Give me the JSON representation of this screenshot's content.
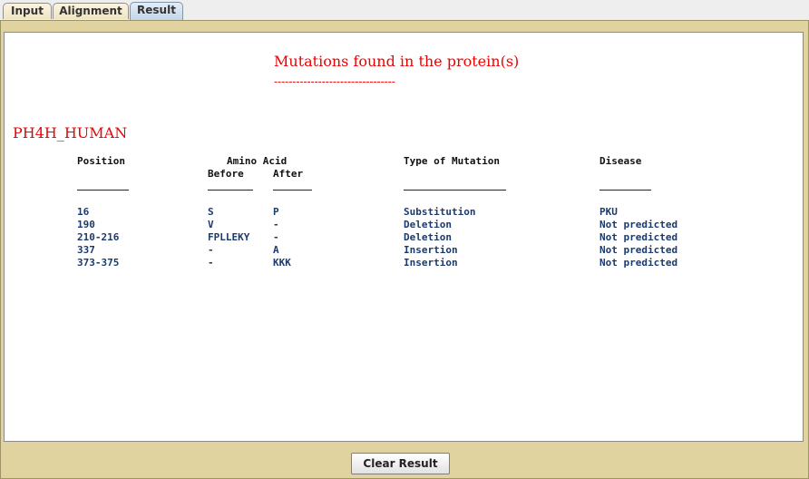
{
  "tabs": [
    {
      "label": "Input"
    },
    {
      "label": "Alignment"
    },
    {
      "label": "Result"
    }
  ],
  "result": {
    "title": "Mutations found in the protein(s)",
    "title_underline": "---------------------------------",
    "protein_name": "PH4H_HUMAN",
    "headers": {
      "position": "Position",
      "amino_acid": "Amino Acid",
      "before": "Before",
      "after": "After",
      "type": "Type of Mutation",
      "disease": "Disease"
    },
    "rows": [
      {
        "position": "16",
        "before": "S",
        "after": "P",
        "type": "Substitution",
        "disease": "PKU"
      },
      {
        "position": "190",
        "before": "V",
        "after": "-",
        "type": "Deletion",
        "disease": "Not predicted"
      },
      {
        "position": "210-216",
        "before": "FPLLEKY",
        "after": "-",
        "type": "Deletion",
        "disease": "Not predicted"
      },
      {
        "position": "337",
        "before": "-",
        "after": "A",
        "type": "Insertion",
        "disease": "Not predicted"
      },
      {
        "position": "373-375",
        "before": "-",
        "after": "KKK",
        "type": "Insertion",
        "disease": "Not predicted"
      }
    ]
  },
  "footer": {
    "clear_button": "Clear Result"
  },
  "colors": {
    "title_red": "#ee0000",
    "data_blue": "#1b3a6e",
    "panel_tan": "#e0d3a0"
  }
}
